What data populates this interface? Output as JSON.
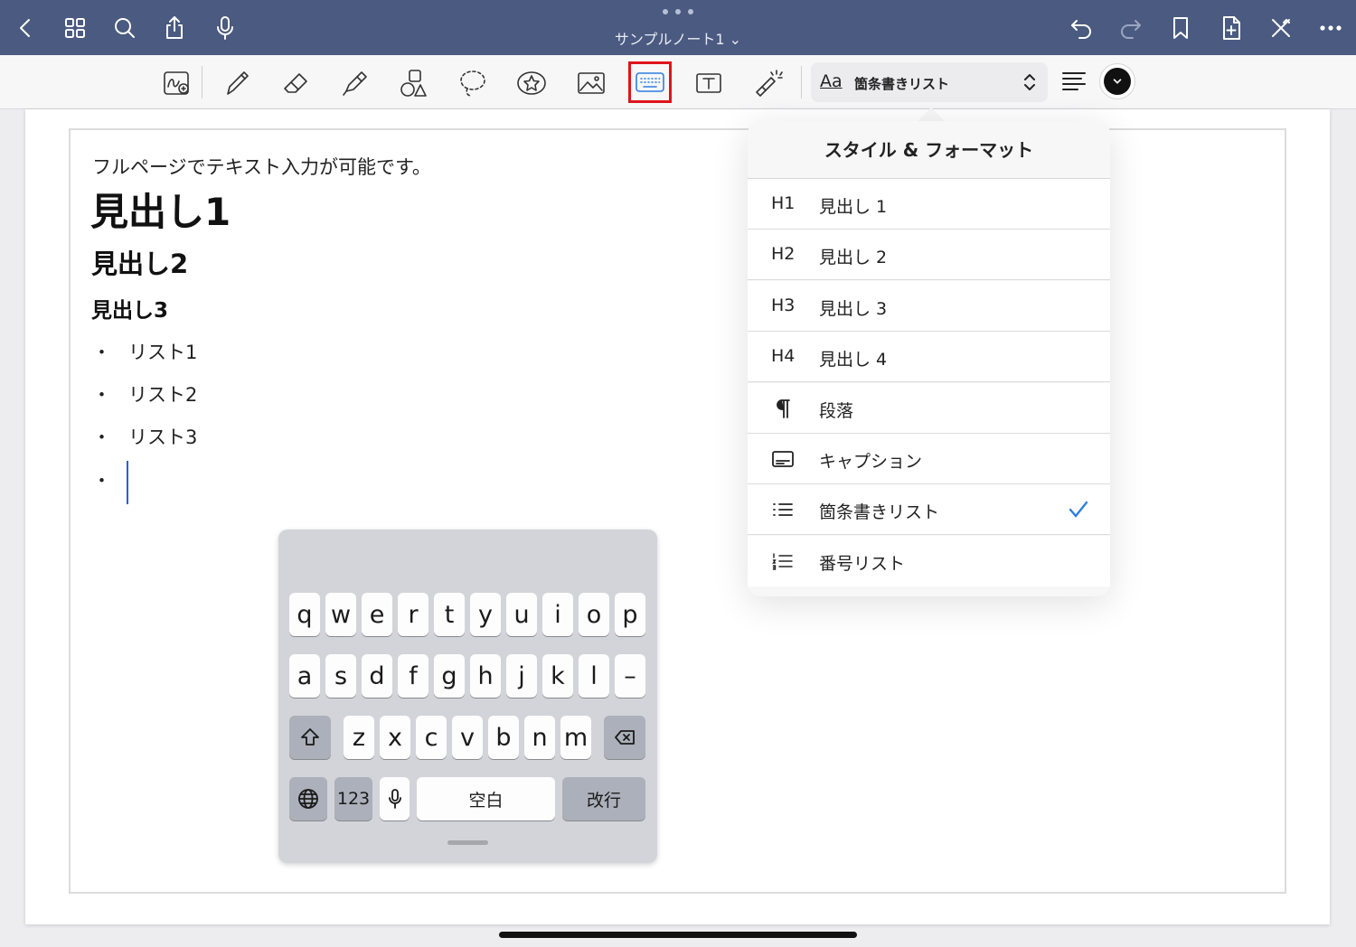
{
  "titlebar": {
    "doc_title": "サンプルノート1 ⌄"
  },
  "toolbar": {
    "style_aa": "Aa",
    "style_current": "箇条書きリスト",
    "selected_tool": "keyboard-tool",
    "accent_color": "#e0141c",
    "pen_color": "#111111"
  },
  "page": {
    "intro": "フルページでテキスト入力が可能です。",
    "h1": "見出し1",
    "h2": "見出し2",
    "h3": "見出し3",
    "bullet": "・",
    "list": [
      "リスト1",
      "リスト2",
      "リスト3",
      ""
    ]
  },
  "keyboard": {
    "row1": [
      "q",
      "w",
      "e",
      "r",
      "t",
      "y",
      "u",
      "i",
      "o",
      "p"
    ],
    "row2": [
      "a",
      "s",
      "d",
      "f",
      "g",
      "h",
      "j",
      "k",
      "l",
      "–"
    ],
    "row3": [
      "z",
      "x",
      "c",
      "v",
      "b",
      "n",
      "m"
    ],
    "numbers_label": "123",
    "space_label": "空白",
    "return_label": "改行"
  },
  "popover": {
    "title": "スタイル & フォーマット",
    "options": [
      {
        "code": "H1",
        "label": "見出し 1"
      },
      {
        "code": "H2",
        "label": "見出し 2"
      },
      {
        "code": "H3",
        "label": "見出し 3"
      },
      {
        "code": "H4",
        "label": "見出し 4"
      },
      {
        "code": "",
        "label": "段落",
        "icon": "pilcrow-icon"
      },
      {
        "code": "",
        "label": "キャプション",
        "icon": "caption-icon"
      },
      {
        "code": "",
        "label": "箇条書きリスト",
        "icon": "bullet-list-icon",
        "selected": true
      },
      {
        "code": "",
        "label": "番号リスト",
        "icon": "numbered-list-icon"
      }
    ],
    "check_color": "#2f7de1"
  }
}
